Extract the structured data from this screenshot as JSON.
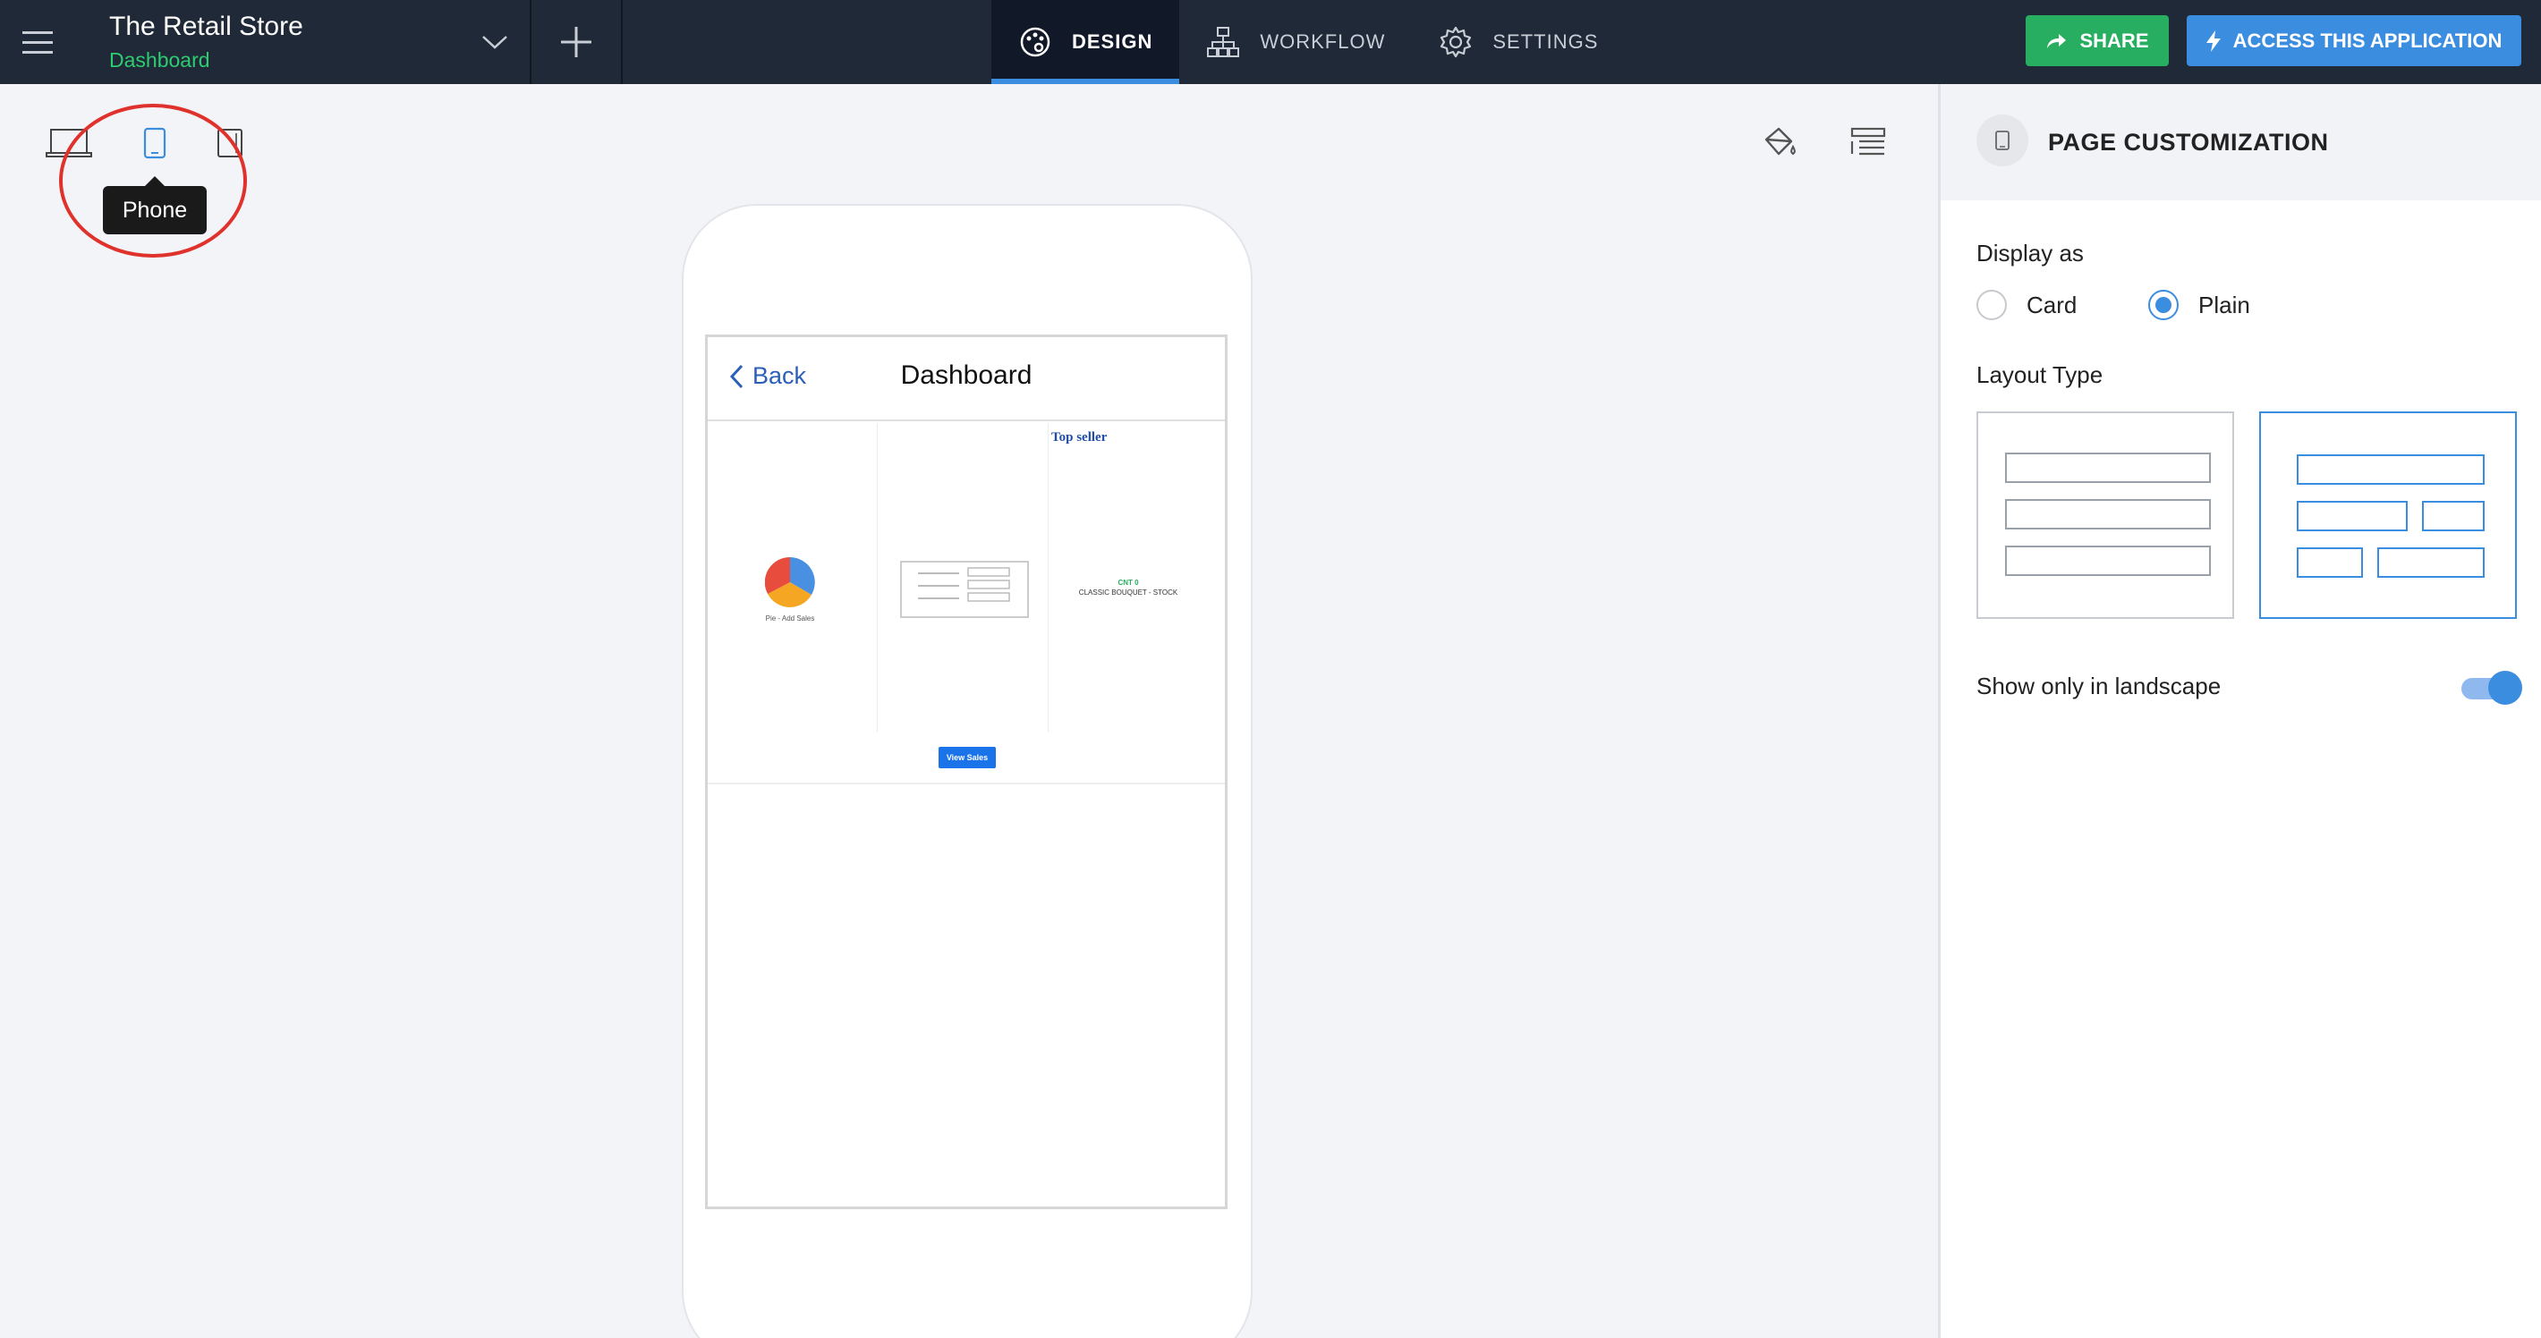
{
  "topbar": {
    "app_title": "The Retail Store",
    "app_subtitle": "Dashboard",
    "tabs": [
      {
        "label": "DESIGN",
        "icon": "palette-icon",
        "active": true
      },
      {
        "label": "WORKFLOW",
        "icon": "workflow-icon",
        "active": false
      },
      {
        "label": "SETTINGS",
        "icon": "gear-icon",
        "active": false
      }
    ],
    "share_label": "SHARE",
    "access_label": "ACCESS THIS APPLICATION"
  },
  "device_switcher": {
    "devices": [
      "laptop-icon",
      "phone-icon",
      "tablet-icon"
    ],
    "selected": "phone-icon",
    "tooltip": "Phone"
  },
  "toolbar_icons": [
    "paint-bucket-icon",
    "page-layout-icon"
  ],
  "preview": {
    "back_label": "Back",
    "page_title": "Dashboard",
    "top_seller_label": "Top seller",
    "pie_caption": "Pie - Add Sales",
    "metric_label": "CNT 0",
    "metric_value": "CLASSIC BOUQUET - STOCK",
    "view_sales_label": "View Sales"
  },
  "panel": {
    "title": "PAGE CUSTOMIZATION",
    "display_as_label": "Display as",
    "display_options": [
      {
        "label": "Card",
        "selected": false
      },
      {
        "label": "Plain",
        "selected": true
      }
    ],
    "layout_type_label": "Layout Type",
    "layout_selected": "grid",
    "landscape_label": "Show only in landscape",
    "landscape_on": true
  },
  "colors": {
    "topbar_bg": "#1f2937",
    "accent_blue": "#3b8de0",
    "share_green": "#27ae60",
    "subtitle_green": "#2ecc71",
    "highlight_red": "#e0322c"
  }
}
